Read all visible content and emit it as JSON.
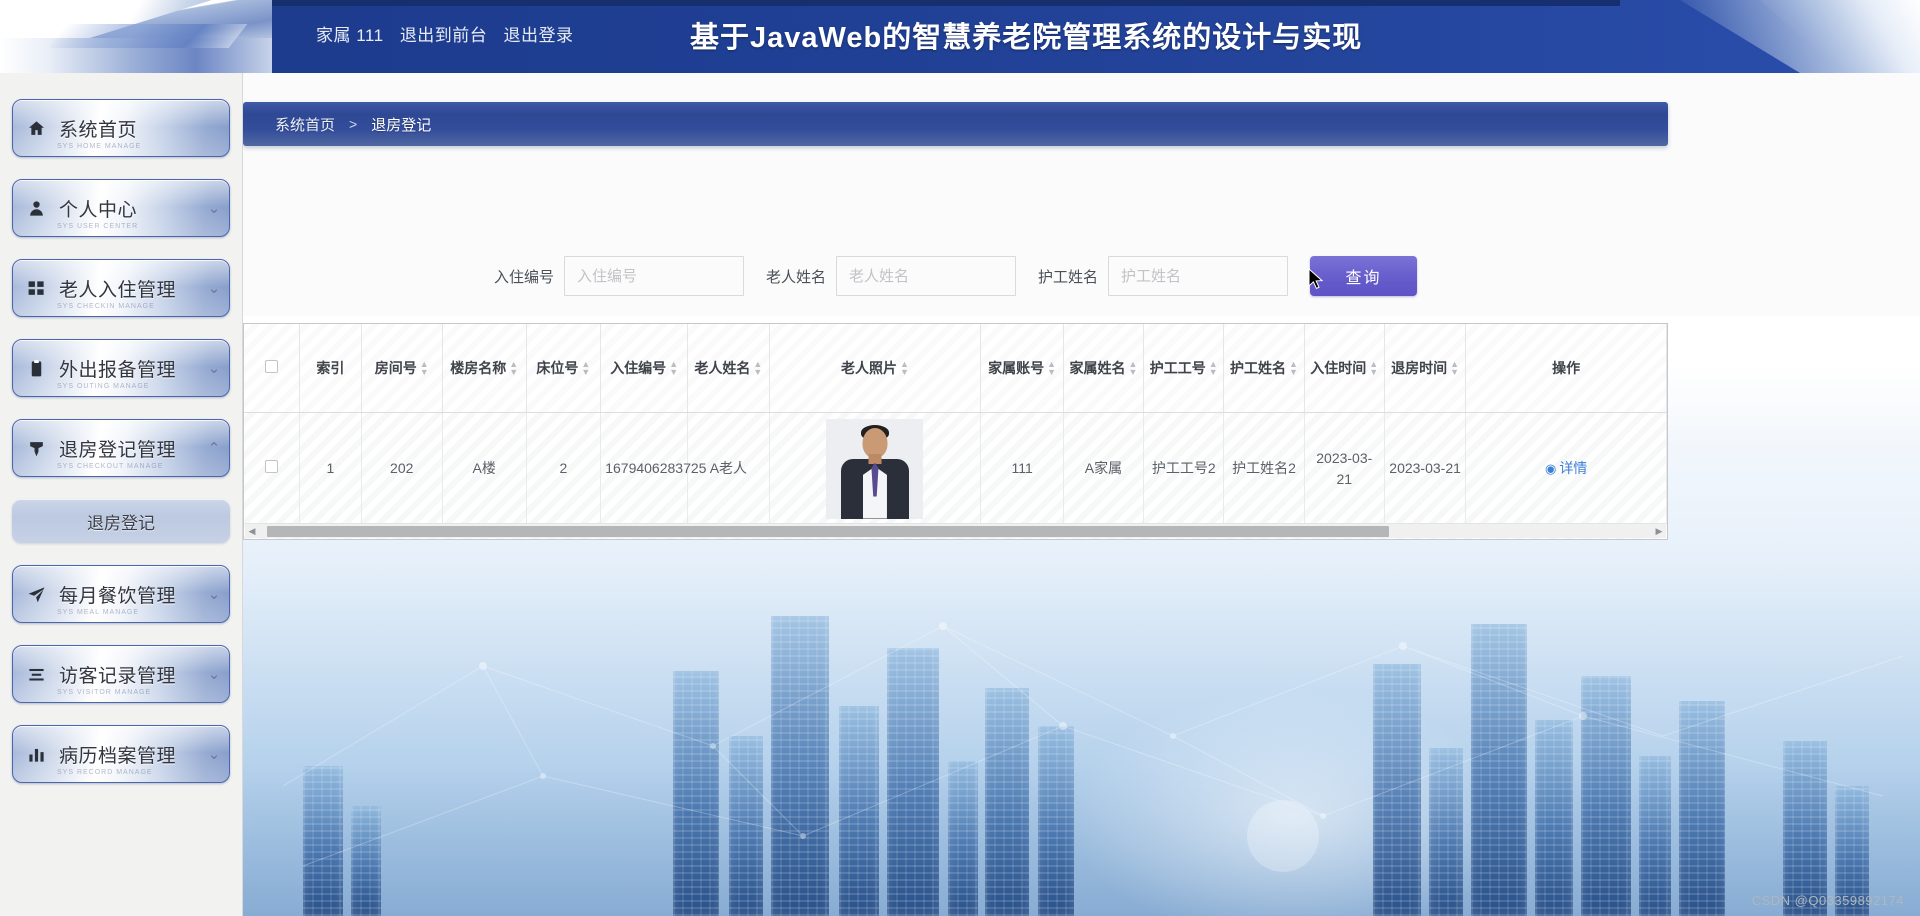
{
  "header": {
    "user_segments": [
      "家属 111",
      "退出到前台",
      "退出登录"
    ],
    "title": "基于JavaWeb的智慧养老院管理系统的设计与实现"
  },
  "sidebar": {
    "items": [
      {
        "label": "系统首页",
        "icon": "home-icon",
        "arrow": "",
        "ghost": "SYS HOME MANAGE"
      },
      {
        "label": "个人中心",
        "icon": "user-icon",
        "arrow": "⌄",
        "ghost": "SYS USER CENTER"
      },
      {
        "label": "老人入住管理",
        "icon": "grid-icon",
        "arrow": "⌄",
        "ghost": "SYS CHECKIN MANAGE"
      },
      {
        "label": "外出报备管理",
        "icon": "clipboard-icon",
        "arrow": "⌄",
        "ghost": "SYS OUTING MANAGE"
      },
      {
        "label": "退房登记管理",
        "icon": "pin-icon",
        "arrow": "⌃",
        "ghost": "SYS CHECKOUT MANAGE"
      },
      {
        "label": "每月餐饮管理",
        "icon": "send-icon",
        "arrow": "⌄",
        "ghost": "SYS MEAL MANAGE"
      },
      {
        "label": "访客记录管理",
        "icon": "list-icon",
        "arrow": "⌄",
        "ghost": "SYS VISITOR MANAGE"
      },
      {
        "label": "病历档案管理",
        "icon": "chart-icon",
        "arrow": "⌄",
        "ghost": "SYS RECORD MANAGE"
      }
    ],
    "submenu": {
      "label": "退房登记",
      "after_index": 4
    }
  },
  "breadcrumb": {
    "home": "系统首页",
    "separator": ">",
    "current": "退房登记"
  },
  "search": {
    "fields": [
      {
        "label": "入住编号",
        "placeholder": "入住编号",
        "value": ""
      },
      {
        "label": "老人姓名",
        "placeholder": "老人姓名",
        "value": ""
      },
      {
        "label": "护工姓名",
        "placeholder": "护工姓名",
        "value": ""
      }
    ],
    "button_label": "查询"
  },
  "table": {
    "columns": [
      {
        "key": "checkbox",
        "label": "",
        "sortable": false
      },
      {
        "key": "index",
        "label": "索引",
        "sortable": false
      },
      {
        "key": "room_no",
        "label": "房间号",
        "sortable": true
      },
      {
        "key": "building",
        "label": "楼房名称",
        "sortable": true
      },
      {
        "key": "bed_no",
        "label": "床位号",
        "sortable": true
      },
      {
        "key": "checkin_id",
        "label": "入住编号",
        "sortable": true
      },
      {
        "key": "elder_name",
        "label": "老人姓名",
        "sortable": true
      },
      {
        "key": "photo",
        "label": "老人照片",
        "sortable": true
      },
      {
        "key": "family_acc",
        "label": "家属账号",
        "sortable": true
      },
      {
        "key": "family_name",
        "label": "家属姓名",
        "sortable": true
      },
      {
        "key": "nurse_no",
        "label": "护工工号",
        "sortable": true
      },
      {
        "key": "nurse_name",
        "label": "护工姓名",
        "sortable": true
      },
      {
        "key": "checkin_time",
        "label": "入住时间",
        "sortable": true
      },
      {
        "key": "checkout_time",
        "label": "退房时间",
        "sortable": true
      },
      {
        "key": "action",
        "label": "操作",
        "sortable": false
      }
    ],
    "rows": [
      {
        "index": "1",
        "room_no": "202",
        "building": "A楼",
        "bed_no": "2",
        "checkin_id": "1679406283725",
        "elder_name": "A老人",
        "photo_alt": "老人照片",
        "family_acc": "111",
        "family_name": "A家属",
        "nurse_no": "护工工号2",
        "nurse_name": "护工姓名2",
        "checkin_time": "2023-03-21",
        "checkout_time": "2023-03-21",
        "action_label": "详情"
      }
    ]
  },
  "scrollbar": {
    "left_arrow": "◀",
    "right_arrow": "▶"
  },
  "watermark": "CSDN @Q03359892174",
  "colors": {
    "header_blue": "#1f3f94",
    "crumb_blue": "#33499a",
    "accent_purple": "#6258c8",
    "link_blue": "#3d80d9"
  }
}
